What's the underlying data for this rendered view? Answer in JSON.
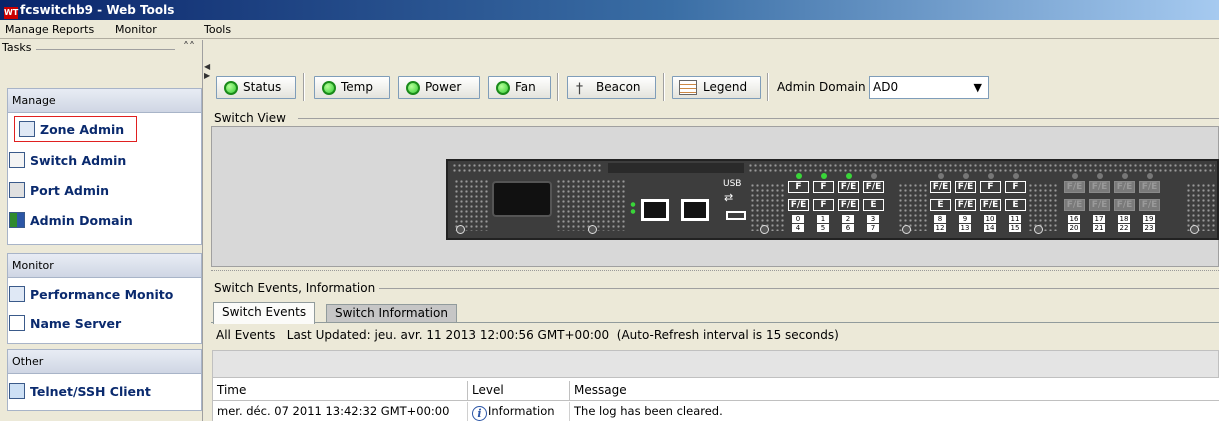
{
  "window": {
    "title": "fcswitchb9 - Web Tools",
    "icon": "web-tools-icon"
  },
  "menu": [
    "Manage",
    "Reports",
    "Monitor",
    "Tools"
  ],
  "tasks": {
    "label": "Tasks",
    "groups": [
      {
        "title": "Manage",
        "items": [
          "Zone Admin",
          "Switch Admin",
          "Port Admin",
          "Admin Domain"
        ]
      },
      {
        "title": "Monitor",
        "items": [
          "Performance Monito",
          "Name Server"
        ]
      },
      {
        "title": "Other",
        "items": [
          "Telnet/SSH Client"
        ]
      }
    ],
    "selected": "Zone Admin"
  },
  "toolbar": {
    "status": "Status",
    "temp": "Temp",
    "power": "Power",
    "fan": "Fan",
    "beacon": "Beacon",
    "legend": "Legend",
    "admin_domain_label": "Admin Domain",
    "admin_domain_value": "AD0",
    "status_color": "#33cc33"
  },
  "switch_view": {
    "label": "Switch View",
    "usb_label": "USB",
    "ports_row1": [
      "F",
      "F",
      "F/E",
      "F/E",
      "F/E",
      "F/E",
      "F",
      "F",
      "F/E",
      "F/E",
      "F/E",
      "F/E"
    ],
    "ports_row2": [
      "F/E",
      "F",
      "F/E",
      "E",
      "E",
      "F/E",
      "F/E",
      "E",
      "F/E",
      "F/E",
      "F/E",
      "F/E"
    ],
    "port_numbers": [
      "0",
      "1",
      "2",
      "3",
      "8",
      "9",
      "10",
      "11",
      "16",
      "17",
      "18",
      "19"
    ],
    "port_numbers_row2": [
      "4",
      "5",
      "6",
      "7",
      "12",
      "13",
      "14",
      "15",
      "20",
      "21",
      "22",
      "23"
    ]
  },
  "events": {
    "section_label": "Switch Events, Information",
    "tabs": [
      "Switch Events",
      "Switch Information"
    ],
    "status_line": "All Events   Last Updated: jeu. avr. 11 2013 12:00:56 GMT+00:00  (Auto-Refresh interval is 15 seconds)",
    "columns": [
      "Time",
      "Level",
      "Message"
    ],
    "rows": [
      {
        "time": "mer. déc. 07 2011 13:42:32 GMT+00:00",
        "level": "Information",
        "message": "The log has been cleared."
      }
    ]
  }
}
